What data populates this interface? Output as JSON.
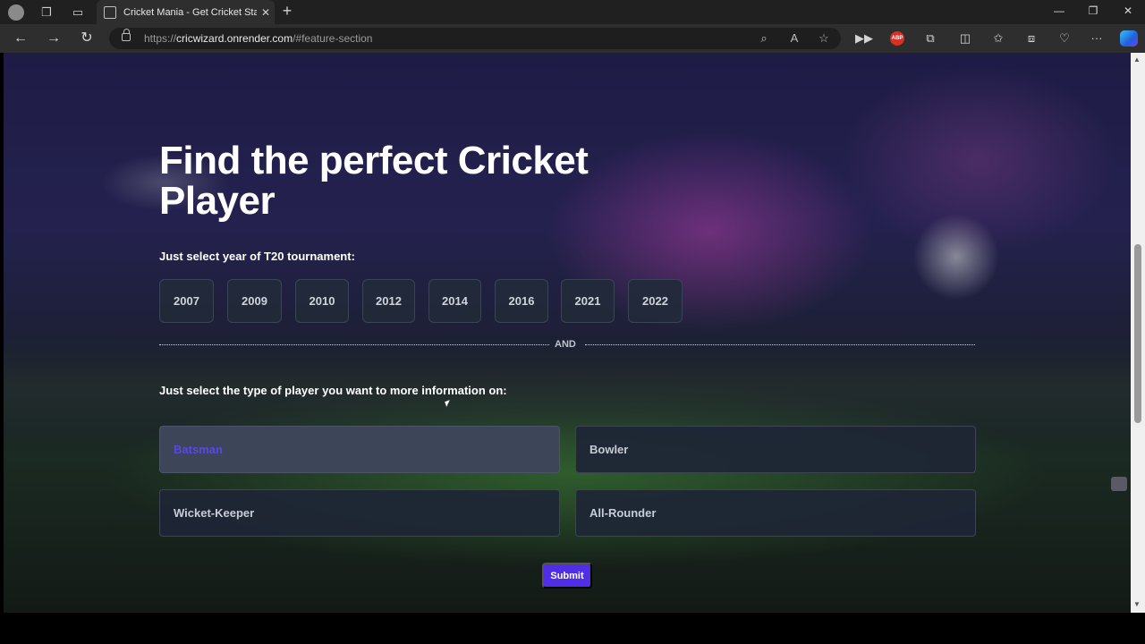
{
  "browser": {
    "tab_title": "Cricket Mania - Get Cricket Stats",
    "url_prefix": "https://",
    "url_host": "cricwizard.onrender.com",
    "url_path": "/#feature-section"
  },
  "page": {
    "heading": "Find the perfect Cricket Player",
    "year_prompt": "Just select year of T20 tournament:",
    "years": [
      "2007",
      "2009",
      "2010",
      "2012",
      "2014",
      "2016",
      "2021",
      "2022"
    ],
    "divider_label": "AND",
    "type_prompt": "Just select the type of player you want to more information on:",
    "player_types": [
      "Batsman",
      "Bowler",
      "Wicket-Keeper",
      "All-Rounder"
    ],
    "selected_type": "Batsman",
    "submit_label": "Submit"
  },
  "colors": {
    "accent": "#4f2ee6",
    "selected_text": "#5b47e6",
    "button_bg": "#222a3a"
  },
  "icons": [
    "profile-icon",
    "workspaces-icon",
    "tab-actions-icon",
    "favicon-icon",
    "close-icon",
    "plus-icon",
    "minimize-icon",
    "restore-icon",
    "window-close-icon",
    "back-icon",
    "forward-icon",
    "refresh-icon",
    "lock-icon",
    "zoom-icon",
    "read-aloud-icon",
    "favorite-star-icon",
    "media-icon",
    "adblock-icon",
    "extensions-icon",
    "split-screen-icon",
    "favorites-icon",
    "collections-icon",
    "browser-essentials-icon",
    "more-icon",
    "copilot-icon"
  ]
}
